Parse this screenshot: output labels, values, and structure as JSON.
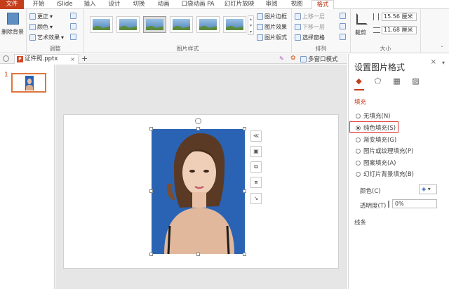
{
  "ribbon_tabs": [
    "文件",
    "开始",
    "iSlide",
    "插入",
    "设计",
    "切换",
    "动画",
    "口袋动画 PA",
    "幻灯片放映",
    "审阅",
    "视图",
    "格式"
  ],
  "ribbon": {
    "remove_bg": "删除背景",
    "adjust": {
      "correct": "更正",
      "color": "颜色",
      "art": "艺术效果",
      "label": "调整"
    },
    "styles_label": "图片样式",
    "picture_options": [
      "图片边框",
      "图片效果",
      "图片版式"
    ],
    "arrange": {
      "up": "上移一层",
      "down": "下移一层",
      "pane": "选择窗格",
      "label": "排列"
    },
    "crop": "裁剪",
    "size": {
      "height": "15.56 厘米",
      "width": "11.68 厘米",
      "label": "大小"
    }
  },
  "docbar": {
    "filename": "证件照.pptx",
    "add": "+",
    "multiwin": "多窗口模式"
  },
  "slides": {
    "number": "1"
  },
  "format_pane": {
    "title": "设置图片格式",
    "section": "填充",
    "options": [
      "无填充(N)",
      "纯色填充(S)",
      "渐变填充(G)",
      "图片或纹理填充(P)",
      "图案填充(A)",
      "幻灯片背景填充(B)"
    ],
    "selected_index": 1,
    "color_label": "颜色(C)",
    "transparency_label": "透明度(T)",
    "transparency_value": "0%",
    "line_section": "线条"
  },
  "colors": {
    "accent": "#c43e1c",
    "photo_bg": "#2a63b4",
    "highlight": "#e0302b"
  }
}
